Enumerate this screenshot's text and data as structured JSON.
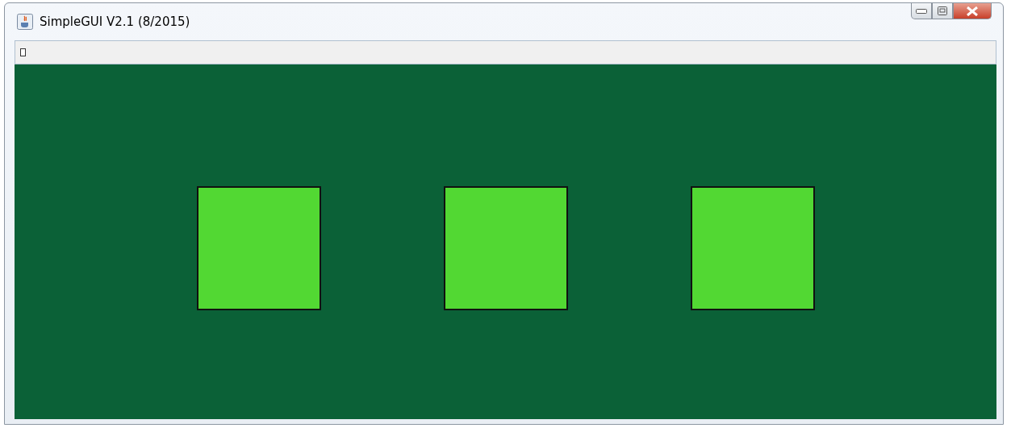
{
  "window": {
    "title": "SimpleGUI V2.1 (8/2015)"
  },
  "canvas": {
    "shapes": [
      {
        "kind": "square"
      },
      {
        "kind": "square"
      },
      {
        "kind": "square"
      }
    ]
  }
}
